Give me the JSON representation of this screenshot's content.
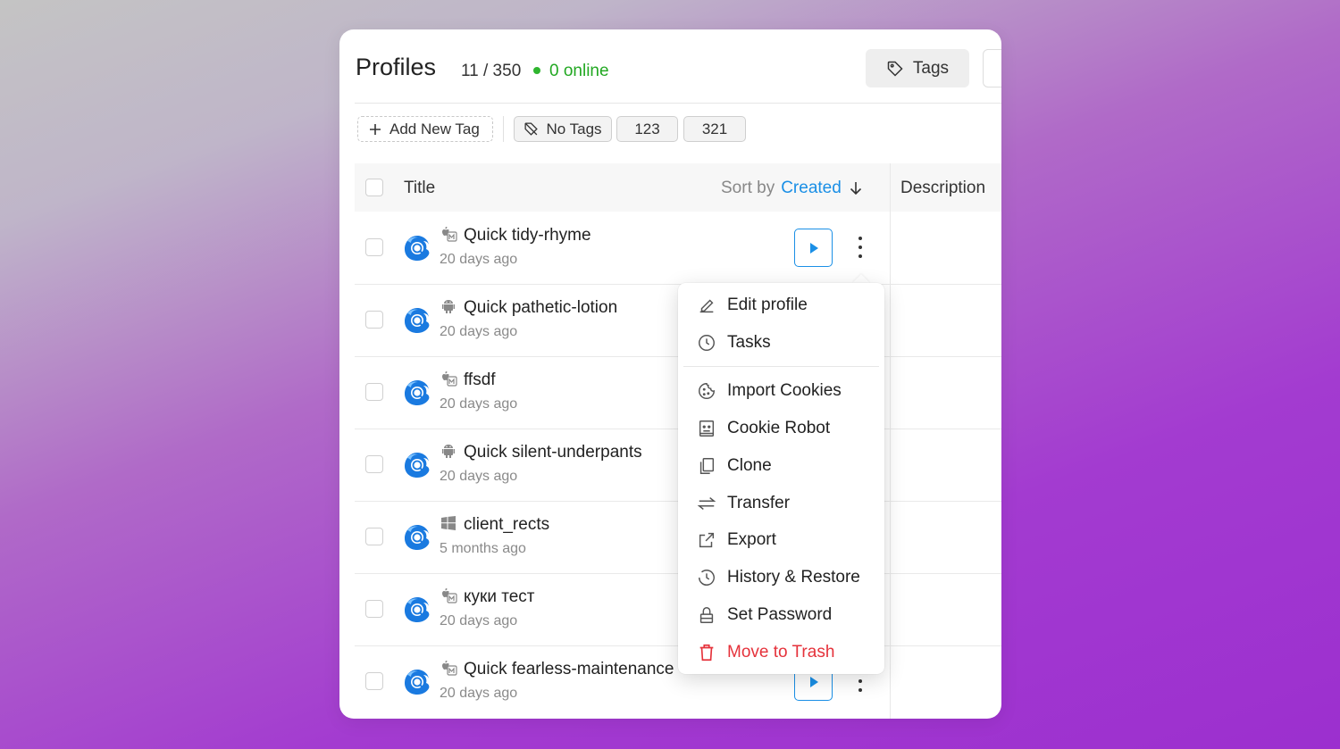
{
  "header": {
    "title": "Profiles",
    "count": "11 / 350",
    "online": "0 online",
    "tags_button": "Tags"
  },
  "tag_bar": {
    "add_tag": "Add New Tag",
    "no_tags": "No Tags",
    "tags": [
      "123",
      "321"
    ]
  },
  "table": {
    "col_title": "Title",
    "sort_prefix": "Sort by",
    "sort_field": "Created",
    "col_description": "Description",
    "rows": [
      {
        "name": "Quick tidy-rhyme",
        "date": "20 days ago",
        "os": "macos-icon"
      },
      {
        "name": "Quick pathetic-lotion",
        "date": "20 days ago",
        "os": "android-icon"
      },
      {
        "name": "ffsdf",
        "date": "20 days ago",
        "os": "macos-icon"
      },
      {
        "name": "Quick silent-underpants",
        "date": "20 days ago",
        "os": "android-icon"
      },
      {
        "name": "client_rects",
        "date": "5 months ago",
        "os": "windows-icon"
      },
      {
        "name": "куки тест",
        "date": "20 days ago",
        "os": "macos-icon"
      },
      {
        "name": "Quick fearless-maintenance",
        "date": "20 days ago",
        "os": "macos-icon"
      }
    ]
  },
  "context_menu": {
    "items": [
      {
        "label": "Edit profile",
        "icon": "pencil-icon"
      },
      {
        "label": "Tasks",
        "icon": "clock-icon"
      },
      {
        "label": "Import Cookies",
        "icon": "cookie-icon"
      },
      {
        "label": "Cookie Robot",
        "icon": "robot-icon"
      },
      {
        "label": "Clone",
        "icon": "copy-icon"
      },
      {
        "label": "Transfer",
        "icon": "transfer-icon"
      },
      {
        "label": "Export",
        "icon": "export-icon"
      },
      {
        "label": "History & Restore",
        "icon": "history-icon"
      },
      {
        "label": "Set Password",
        "icon": "lock-icon"
      },
      {
        "label": "Move to Trash",
        "icon": "trash-icon"
      }
    ]
  },
  "colors": {
    "accent": "#1a8fe6",
    "online": "#22a822",
    "danger": "#e5323b"
  }
}
